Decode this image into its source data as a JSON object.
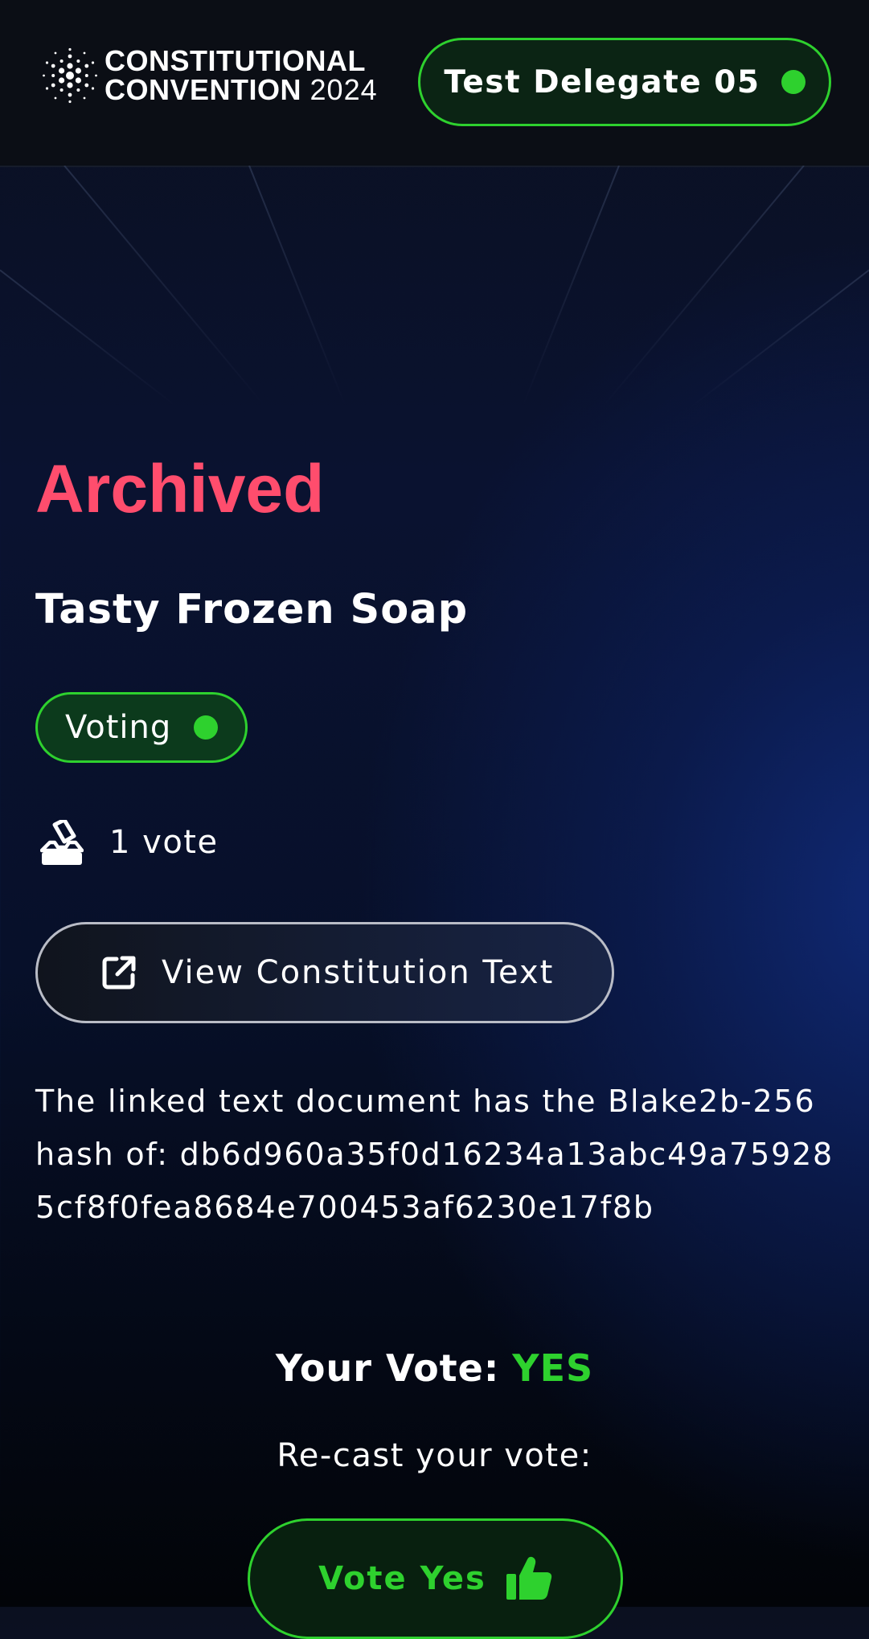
{
  "header": {
    "logo_line1": "CONSTITUTIONAL",
    "logo_line2": "CONVENTION",
    "logo_year": "2024",
    "delegate_name": "Test Delegate 05",
    "delegate_status_color": "#2ed12e"
  },
  "proposal": {
    "status": "Archived",
    "status_color": "#ff4d6d",
    "title": "Tasty Frozen Soap",
    "phase_badge": "Voting",
    "vote_count": "1 vote",
    "view_text_button": "View Constitution Text",
    "hash_description": "The linked text document has the Blake2b-256 hash of: db6d960a35f0d16234a13abc49a759285cf8f0fea8684e700453af6230e17f8b"
  },
  "vote": {
    "label": "Your Vote:",
    "value": "YES",
    "recast_label": "Re-cast your vote:",
    "vote_yes_button": "Vote Yes"
  },
  "icons": {
    "logo": "cardano-logo-icon",
    "vote_count": "ballot-box-icon",
    "view_text": "external-link-icon",
    "vote_yes": "thumbs-up-icon"
  },
  "colors": {
    "accent_green": "#2ed12e",
    "archived_red": "#ff4d6d",
    "header_bg": "#0b0e15"
  }
}
